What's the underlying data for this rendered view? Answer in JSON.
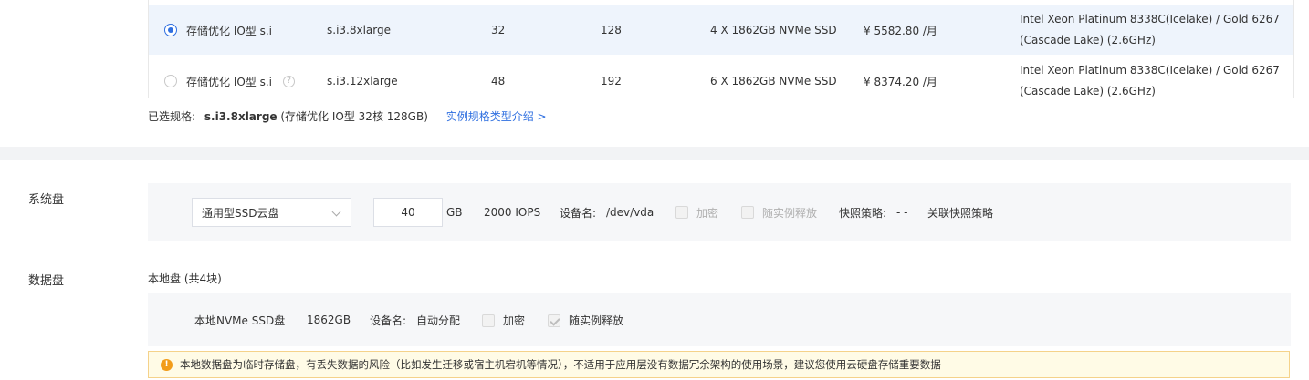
{
  "instance_table": {
    "rows": [
      {
        "selected": true,
        "family": "存储优化 IO型 s.i",
        "spec": "s.i3.8xlarge",
        "vcpu": "32",
        "memory": "128",
        "local_disk": "4 X 1862GB NVMe SSD",
        "price": "¥ 5582.80 /月",
        "cpu": "Intel Xeon Platinum 8338C(Icelake) / Gold 6267 (Cascade Lake) (2.6GHz)"
      },
      {
        "selected": false,
        "family": "存储优化 IO型 s.i",
        "spec": "s.i3.12xlarge",
        "vcpu": "48",
        "memory": "192",
        "local_disk": "6 X 1862GB NVMe SSD",
        "price": "¥ 8374.20 /月",
        "cpu": "Intel Xeon Platinum 8338C(Icelake) / Gold 6267 (Cascade Lake) (2.6GHz)"
      }
    ],
    "help_icon": "question-circle-icon"
  },
  "selected_spec": {
    "label": "已选规格:",
    "value": "s.i3.8xlarge",
    "detail": "(存储优化 IO型 32核 128GB)",
    "link": "实例规格类型介绍 >"
  },
  "system_disk": {
    "label": "系统盘",
    "disk_type": "通用型SSD云盘",
    "size": "40",
    "unit": "GB",
    "iops": "2000 IOPS",
    "device_label": "设备名:",
    "device_value": "/dev/vda",
    "encrypt_label": "加密",
    "release_label": "随实例释放",
    "snapshot_label": "快照策略:",
    "snapshot_value": "- -",
    "snapshot_link": "关联快照策略"
  },
  "data_disk": {
    "label": "数据盘",
    "local_title": "本地盘 (共4块)",
    "disk_name": "本地NVMe SSD盘",
    "disk_size": "1862GB",
    "device_label": "设备名:",
    "device_value": "自动分配",
    "encrypt_label": "加密",
    "release_label": "随实例释放",
    "release_checked": true
  },
  "warning": {
    "icon": "exclamation-circle-icon",
    "text": "本地数据盘为临时存储盘，有丢失数据的风险（比如发生迁移或宿主机宕机等情况），不适用于应用层没有数据冗余架构的使用场景，建议您使用云硬盘存储重要数据"
  },
  "colors": {
    "accent": "#2f6fe0",
    "selected_row_bg": "#eef4fc",
    "warning_bg": "#fffbe6",
    "warning_border": "#f5d28a",
    "warning_icon": "#f29c1a"
  }
}
